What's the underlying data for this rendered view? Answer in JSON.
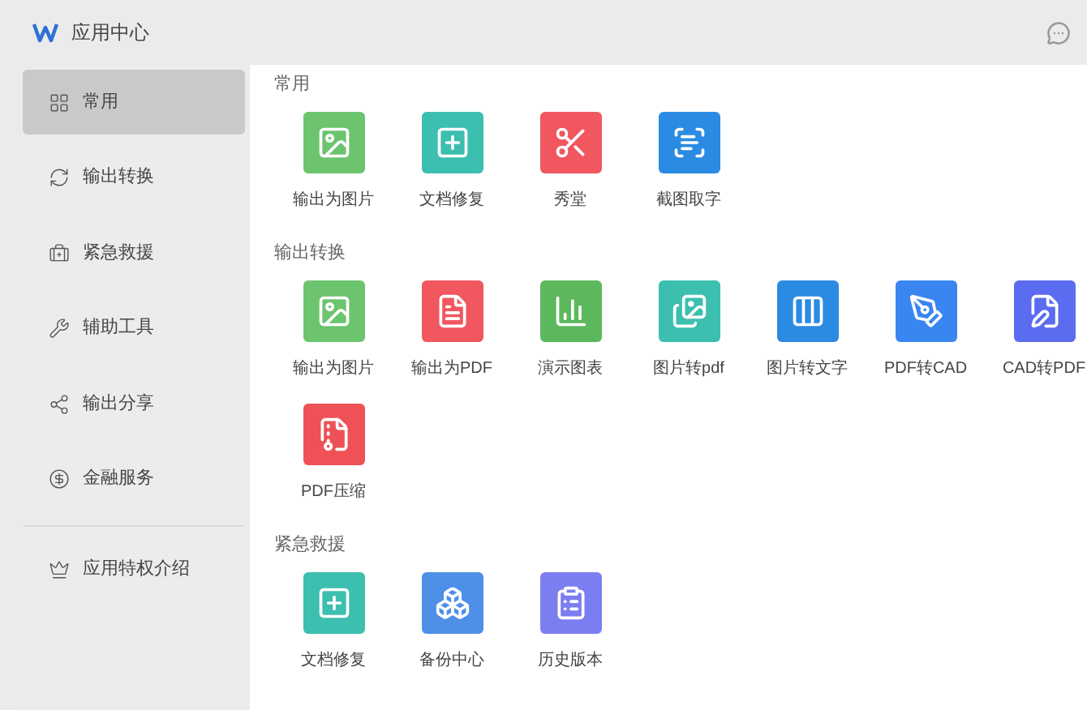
{
  "window": {
    "title": "应用中心"
  },
  "sidebar": {
    "items": [
      {
        "label": "常用",
        "kind": "grid",
        "selected": true
      },
      {
        "label": "输出转换",
        "kind": "convert",
        "selected": false
      },
      {
        "label": "紧急救援",
        "kind": "aid",
        "selected": false
      },
      {
        "label": "辅助工具",
        "kind": "tool",
        "selected": false
      },
      {
        "label": "输出分享",
        "kind": "share",
        "selected": false
      },
      {
        "label": "金融服务",
        "kind": "finance",
        "selected": false
      }
    ],
    "footer_item": {
      "label": "应用特权介绍",
      "kind": "crown"
    }
  },
  "sections": [
    {
      "title": "常用",
      "apps": [
        {
          "label": "输出为图片",
          "kind": "image",
          "color": "#6cc46f"
        },
        {
          "label": "文档修复",
          "kind": "repair",
          "color": "#3dbfb0"
        },
        {
          "label": "秀堂",
          "kind": "show",
          "color": "#f0575f"
        },
        {
          "label": "截图取字",
          "kind": "ocr",
          "color": "#2b8be3"
        }
      ]
    },
    {
      "title": "输出转换",
      "apps": [
        {
          "label": "输出为图片",
          "kind": "image",
          "color": "#6cc46f"
        },
        {
          "label": "输出为PDF",
          "kind": "pdf",
          "color": "#f0575f"
        },
        {
          "label": "演示图表",
          "kind": "chart",
          "color": "#5cb85c"
        },
        {
          "label": "图片转pdf",
          "kind": "img2pdf",
          "color": "#3dbfb0"
        },
        {
          "label": "图片转文字",
          "kind": "img2text",
          "color": "#2b8be3"
        },
        {
          "label": "PDF转CAD",
          "kind": "pdf2cad",
          "color": "#3a86f0"
        },
        {
          "label": "CAD转PDF",
          "kind": "cad2pdf",
          "color": "#5b6cf0"
        },
        {
          "label": "PDF压缩",
          "kind": "compress",
          "color": "#ee5257"
        }
      ]
    },
    {
      "title": "紧急救援",
      "apps": [
        {
          "label": "文档修复",
          "kind": "repair",
          "color": "#3dbfb0"
        },
        {
          "label": "备份中心",
          "kind": "backup",
          "color": "#4e8fe8"
        },
        {
          "label": "历史版本",
          "kind": "history",
          "color": "#7b7ef0"
        }
      ]
    }
  ]
}
